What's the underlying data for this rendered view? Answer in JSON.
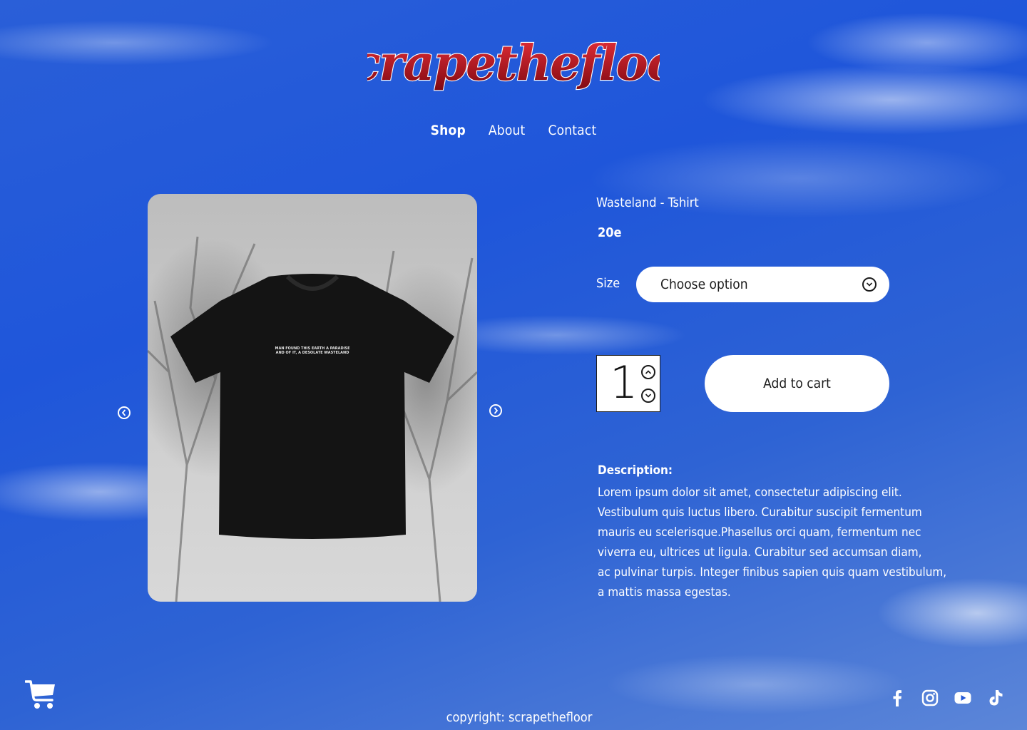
{
  "brand": {
    "logo_text": "scrapethefloor"
  },
  "nav": {
    "items": [
      {
        "label": "Shop",
        "active": true
      },
      {
        "label": "About",
        "active": false
      },
      {
        "label": "Contact",
        "active": false
      }
    ]
  },
  "gallery": {
    "tshirt_print_line1": "MAN FOUND THIS EARTH A PARADISE",
    "tshirt_print_line2": "AND OF IT, A DESOLATE WASTELAND",
    "prev_icon": "chevron-left-circle-icon",
    "next_icon": "chevron-right-circle-icon"
  },
  "product": {
    "name": "Wasteland - Tshirt",
    "price": "20e",
    "size_label": "Size",
    "size_placeholder": "Choose option",
    "quantity": "1",
    "add_to_cart_label": "Add to cart",
    "description_title": "Description:",
    "description_lines": [
      "Lorem ipsum dolor sit amet, consectetur adipiscing elit.",
      "Vestibulum quis luctus libero. Curabitur suscipit fermentum",
      "mauris eu scelerisque.Phasellus orci quam, fermentum nec",
      "viverra eu, ultrices ut ligula. Curabitur sed accumsan diam,",
      "ac pulvinar turpis. Integer finibus sapien quis quam vestibulum,",
      "a mattis massa egestas."
    ]
  },
  "footer": {
    "copyright": "copyright: scrapethefloor",
    "cart_icon": "shopping-cart-icon",
    "social": [
      "facebook-icon",
      "instagram-icon",
      "youtube-icon",
      "tiktok-icon"
    ]
  },
  "colors": {
    "sky_blue": "#1f56da",
    "logo_red": "#b3121c",
    "white": "#ffffff",
    "text_dark": "#1b1b1b"
  }
}
